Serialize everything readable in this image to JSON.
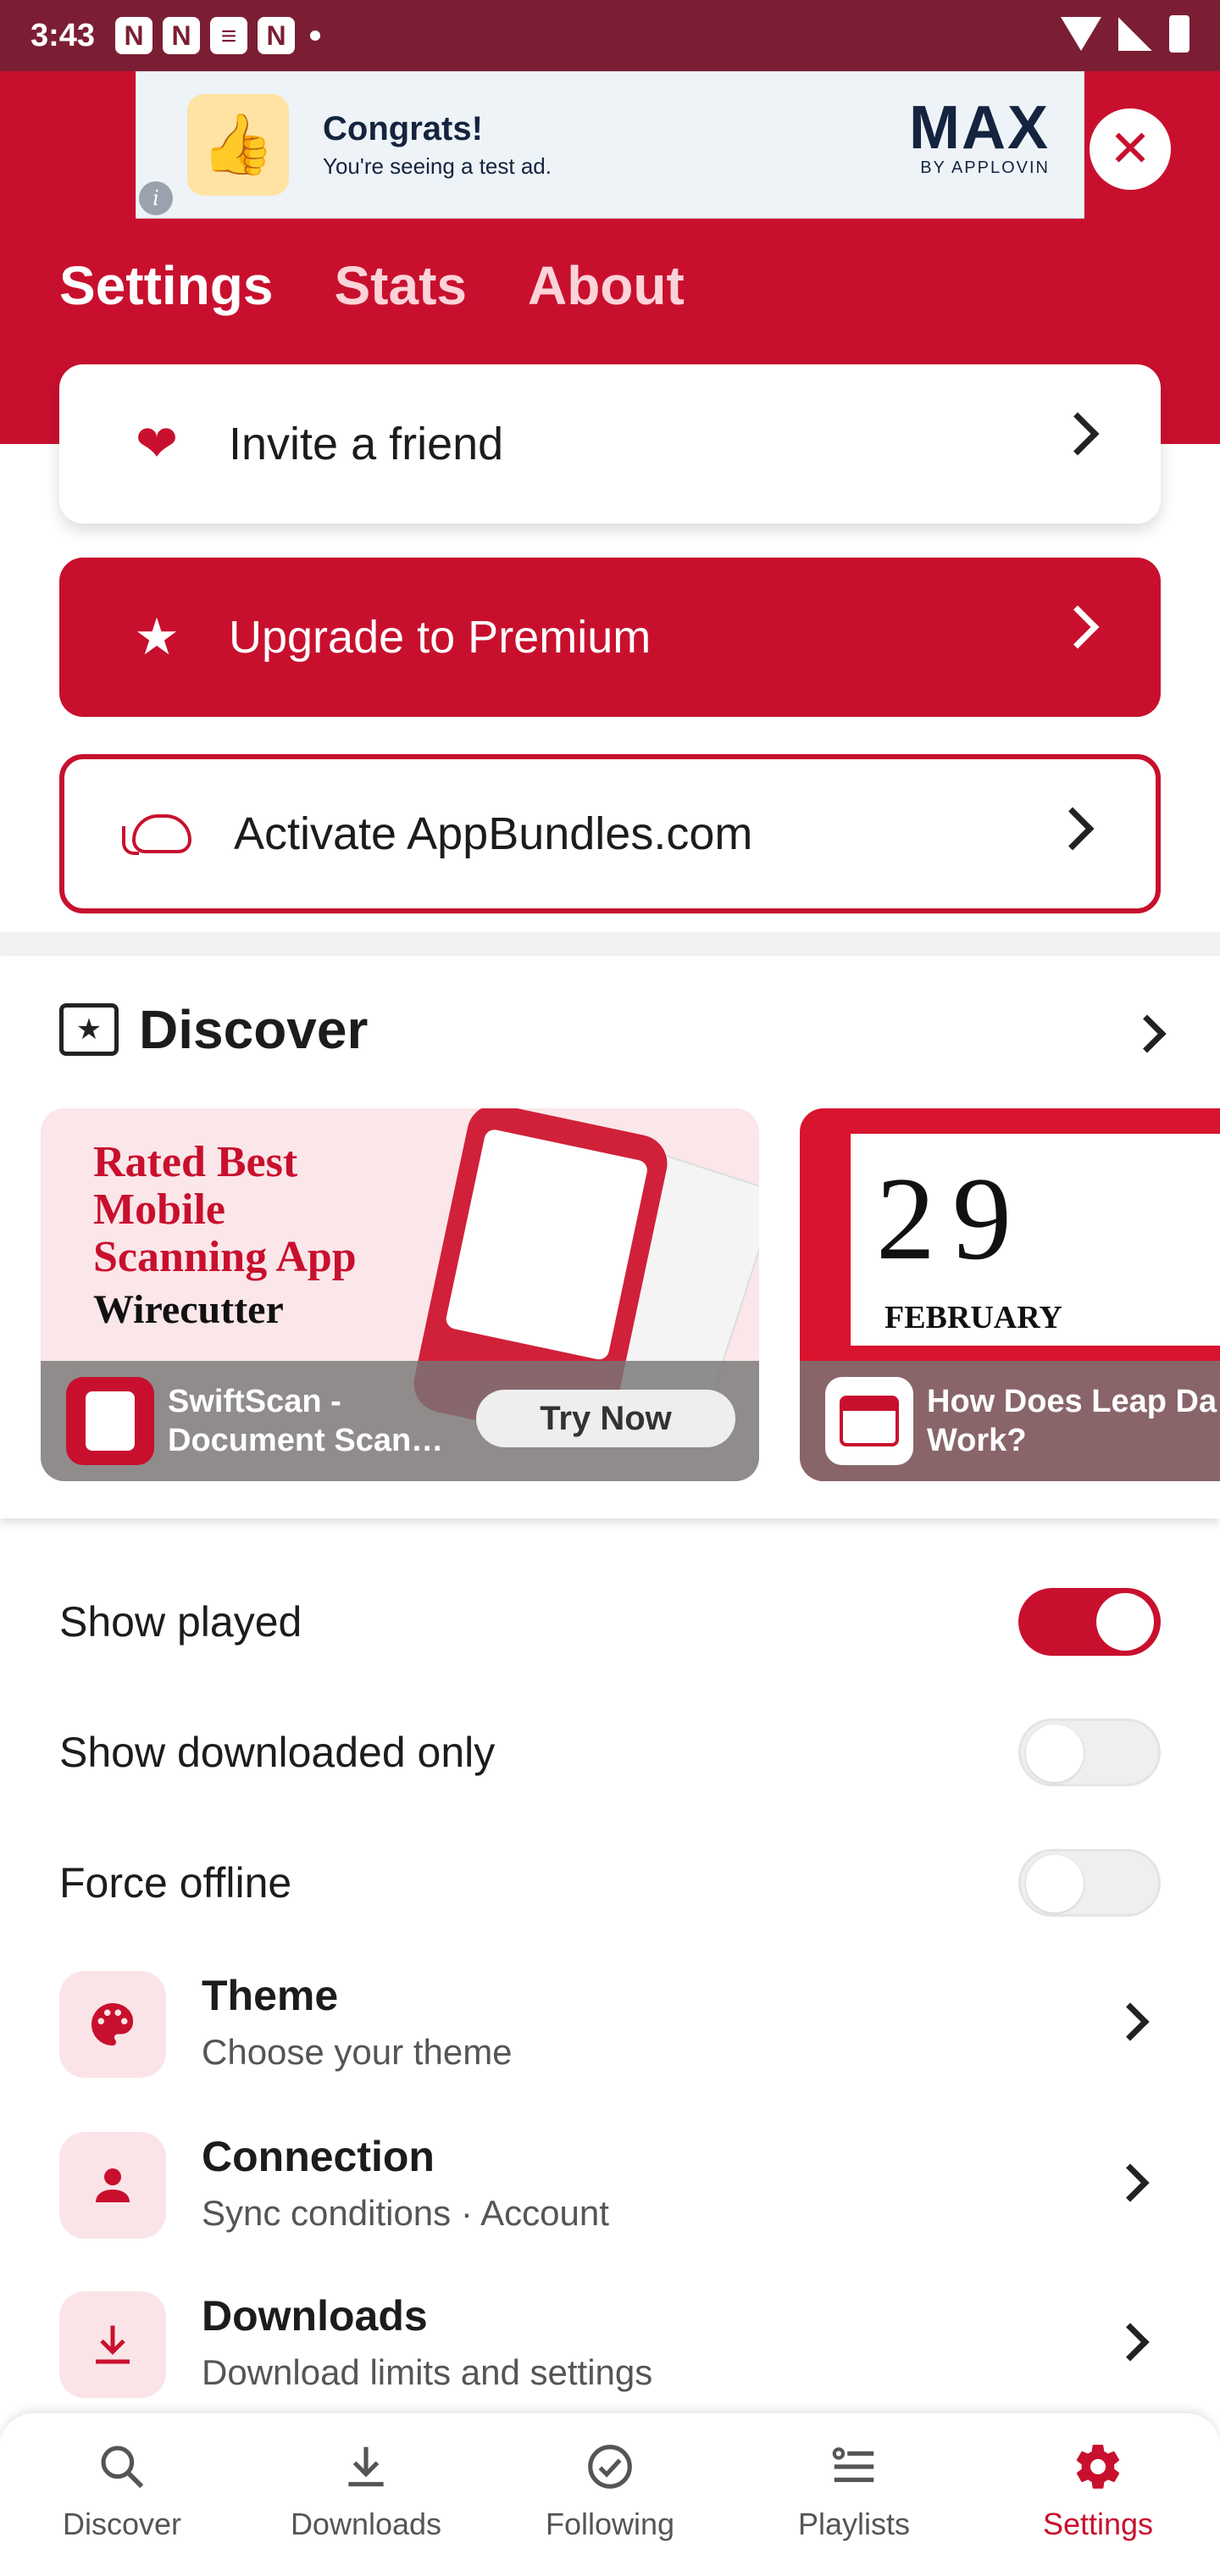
{
  "status_bar": {
    "time": "3:43"
  },
  "ad": {
    "title": "Congrats!",
    "subtitle": "You're seeing a test ad.",
    "brand": "MAX",
    "brand_sub": "BY APPLOVIN",
    "info": "i",
    "close_icon": "close-icon"
  },
  "tabs": [
    {
      "label": "Settings",
      "active": true
    },
    {
      "label": "Stats",
      "active": false
    },
    {
      "label": "About",
      "active": false
    }
  ],
  "cards": {
    "invite": "Invite a friend",
    "premium": "Upgrade to Premium",
    "bundles": "Activate AppBundles.com"
  },
  "discover": {
    "title": "Discover",
    "promos": [
      {
        "headline_1": "Rated Best",
        "headline_2": "Mobile",
        "headline_3": "Scanning App",
        "publisher": "Wirecutter",
        "app_name_1": "SwiftScan -",
        "app_name_2": "Document Scan…",
        "button": "Try Now"
      },
      {
        "date_num": "29",
        "date_month": "FEBRUARY",
        "app_name_1": "How Does Leap Da",
        "app_name_2": "Work?"
      }
    ]
  },
  "toggles": [
    {
      "label": "Show played",
      "on": true
    },
    {
      "label": "Show downloaded only",
      "on": false
    },
    {
      "label": "Force offline",
      "on": false
    }
  ],
  "settings": [
    {
      "title": "Theme",
      "subtitle": "Choose your theme",
      "icon": "palette-icon"
    },
    {
      "title": "Connection",
      "subtitle": "Sync conditions · Account",
      "icon": "account-icon"
    },
    {
      "title": "Downloads",
      "subtitle": "Download limits and settings",
      "icon": "download-icon"
    }
  ],
  "bottom_nav": [
    {
      "label": "Discover",
      "icon": "search-icon"
    },
    {
      "label": "Downloads",
      "icon": "download-icon"
    },
    {
      "label": "Following",
      "icon": "check-circle-icon"
    },
    {
      "label": "Playlists",
      "icon": "playlist-icon"
    },
    {
      "label": "Settings",
      "icon": "gear-icon",
      "active": true
    }
  ],
  "colors": {
    "brand": "#c8102e",
    "status_bar": "#7b1e34"
  }
}
